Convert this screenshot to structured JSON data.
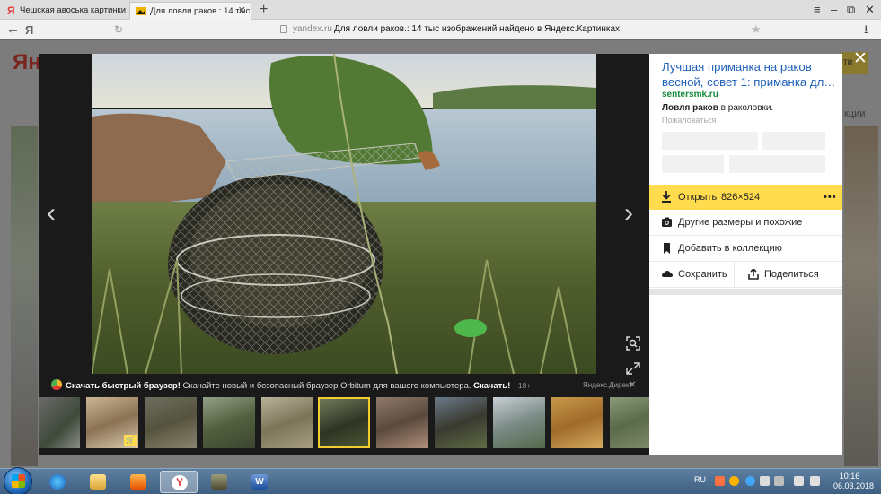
{
  "browser": {
    "tabs": [
      {
        "title": "Чешская авоська картинки –",
        "active": false
      },
      {
        "title": "Для ловли раков.: 14 тыс",
        "active": true
      }
    ],
    "new_tab": "+",
    "address": {
      "domain": "yandex.ru",
      "page_title": "Для ловли раков.: 14 тыс изображений найдено в Яндекс.Картинках"
    }
  },
  "page": {
    "logo": "Янд",
    "right_snippet": "кции",
    "right_button": "ти"
  },
  "viewer": {
    "close": "✕",
    "prev": "‹",
    "next": "›",
    "promo": {
      "bold": "Скачать быстрый браузер!",
      "text": "Скачайте новый и безопасный браузер Orbitum для вашего компьютера.",
      "link": "Скачать!",
      "age": "18+",
      "source": "Яндекс.Директ",
      "close": "✕"
    },
    "thumbnails_count": 11,
    "active_thumbnail": 5
  },
  "sidebar": {
    "ad_title": "Лучшая приманка на раков весной, совет 1: приманка дл…",
    "ad_domain": "sentersmk.ru",
    "ad_text_bold": "Ловля раков",
    "ad_text_rest": " в раколовки.",
    "ad_complain": "Пожаловаться",
    "open_label": "Открыть",
    "open_size": "826×524",
    "more": "•••",
    "other_sizes": "Другие размеры и похожие",
    "add_collection": "Добавить в коллекцию",
    "save": "Сохранить",
    "share": "Поделиться"
  },
  "taskbar": {
    "lang": "RU",
    "time": "10:16",
    "date": "06.03.2018"
  },
  "colors": {
    "accent_yellow": "#ffdb4d",
    "link_blue": "#1f5fb8",
    "domain_green": "#138a3a"
  }
}
